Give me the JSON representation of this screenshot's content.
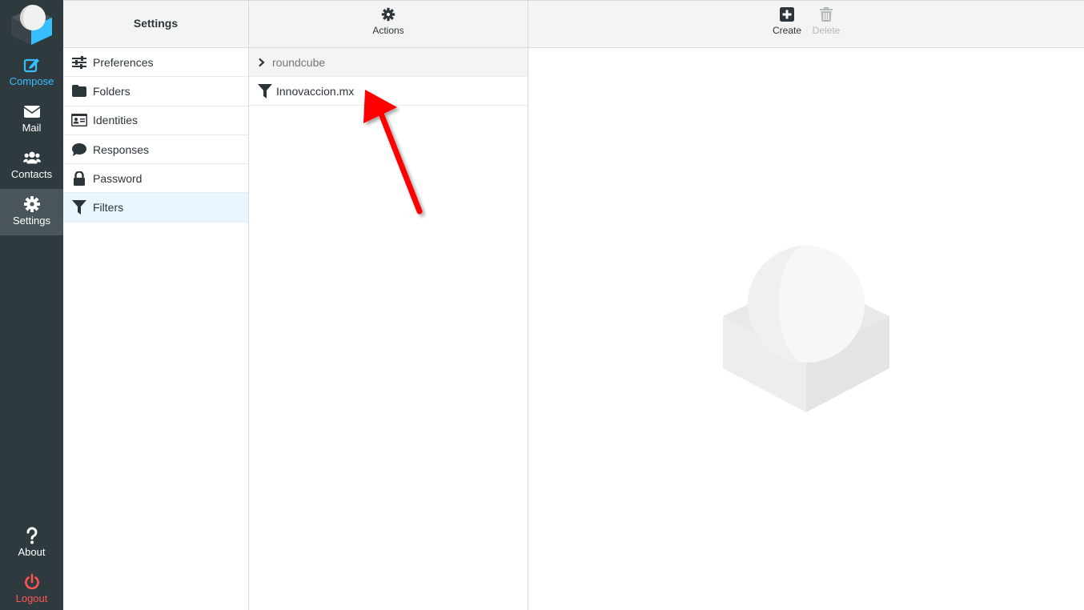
{
  "taskmenu": {
    "compose": "Compose",
    "mail": "Mail",
    "contacts": "Contacts",
    "settings": "Settings",
    "about": "About",
    "logout": "Logout"
  },
  "settings_panel": {
    "title": "Settings",
    "items": [
      {
        "label": "Preferences",
        "icon": "sliders-icon"
      },
      {
        "label": "Folders",
        "icon": "folder-icon"
      },
      {
        "label": "Identities",
        "icon": "id-card-icon"
      },
      {
        "label": "Responses",
        "icon": "comment-icon"
      },
      {
        "label": "Password",
        "icon": "lock-icon"
      },
      {
        "label": "Filters",
        "icon": "filter-icon",
        "selected": true
      }
    ]
  },
  "filters_panel": {
    "actions_label": "Actions",
    "filter_set": "roundcube",
    "filters": [
      "Innovaccion.mx"
    ]
  },
  "content_panel": {
    "create_label": "Create",
    "delete_label": "Delete"
  },
  "colors": {
    "sidebar_bg": "#2f3a3f",
    "accent": "#37beff",
    "logout": "#ff5552",
    "selected_row": "#e9f6fd",
    "annotation_arrow": "#ff0000"
  }
}
